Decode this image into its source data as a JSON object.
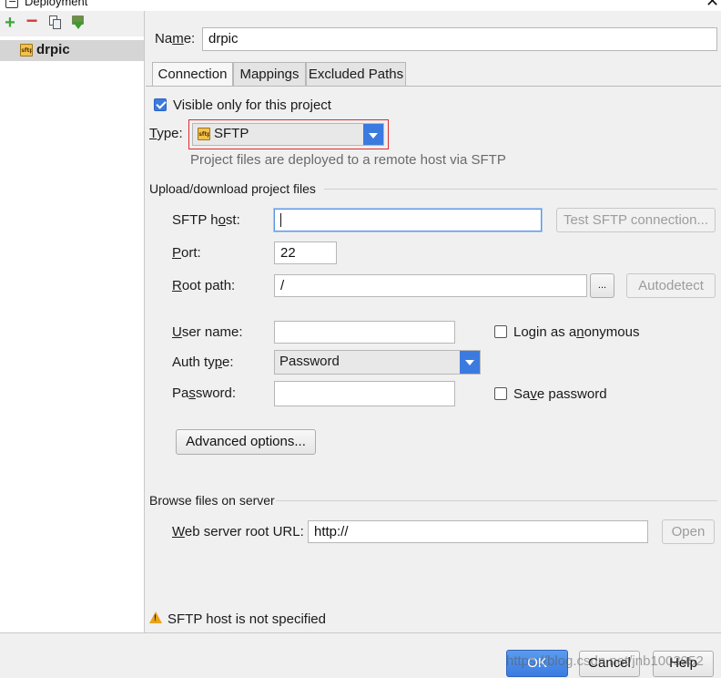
{
  "window": {
    "title": "Deployment",
    "close_glyph": "✕"
  },
  "left_panel": {
    "toolbar": [
      "add-icon",
      "remove-icon",
      "copy-icon",
      "set-default-icon"
    ],
    "servers": [
      {
        "name": "drpic",
        "icon": "sftp-icon",
        "icon_text": "sftp",
        "selected": true
      }
    ]
  },
  "form": {
    "name_label_pre": "Na",
    "name_label_mn": "m",
    "name_label_post": "e:",
    "name_value": "drpic",
    "tabs": [
      {
        "label": "Connection",
        "active": true
      },
      {
        "label": "Mappings",
        "active": false
      },
      {
        "label": "Excluded Paths",
        "active": false
      }
    ]
  },
  "connection": {
    "visible_only": {
      "label": "Visible only for this project",
      "checked": true
    },
    "type": {
      "label_mn": "T",
      "label_rest": "ype:",
      "value": "SFTP",
      "description": "Project files are deployed to a remote host via SFTP",
      "highlight_color": "#e02b2b"
    },
    "upload_section": "Upload/download project files",
    "sftp_host": {
      "label_pre": "SFTP h",
      "label_mn": "o",
      "label_post": "st:",
      "value": "",
      "test_button": "Test SFTP connection..."
    },
    "port": {
      "label_mn": "P",
      "label_rest": "ort:",
      "value": "22"
    },
    "root_path": {
      "label_mn": "R",
      "label_rest": "oot path:",
      "value": "/",
      "browse": "...",
      "autodetect": "Autodetect"
    },
    "user_name": {
      "label_mn": "U",
      "label_rest": "ser name:",
      "value": ""
    },
    "anonymous": {
      "label_pre": "Login as a",
      "label_mn": "n",
      "label_post": "onymous",
      "checked": false
    },
    "auth_type": {
      "label_pre": "Auth ty",
      "label_mn": "p",
      "label_post": "e:",
      "value": "Password"
    },
    "password": {
      "label_pre": "Pa",
      "label_mn": "s",
      "label_post": "sword:",
      "value": ""
    },
    "save_password": {
      "label_pre": "Sa",
      "label_mn": "v",
      "label_post": "e password",
      "checked": false
    },
    "advanced_button": "Advanced options...",
    "browse_section": "Browse files on server",
    "web_root": {
      "label_mn": "W",
      "label_rest": "eb server root URL:",
      "value": "http://",
      "open_button": "Open"
    }
  },
  "status": {
    "icon": "warning-icon",
    "message": "SFTP host is not specified"
  },
  "footer": {
    "ok": "OK",
    "cancel": "Cancel",
    "help": "Help",
    "watermark": "https://blog.csdn.net/jnb1003952"
  },
  "colors": {
    "accent": "#3b7be0",
    "selection": "#d5d5d5",
    "warning": "#e8a317"
  }
}
